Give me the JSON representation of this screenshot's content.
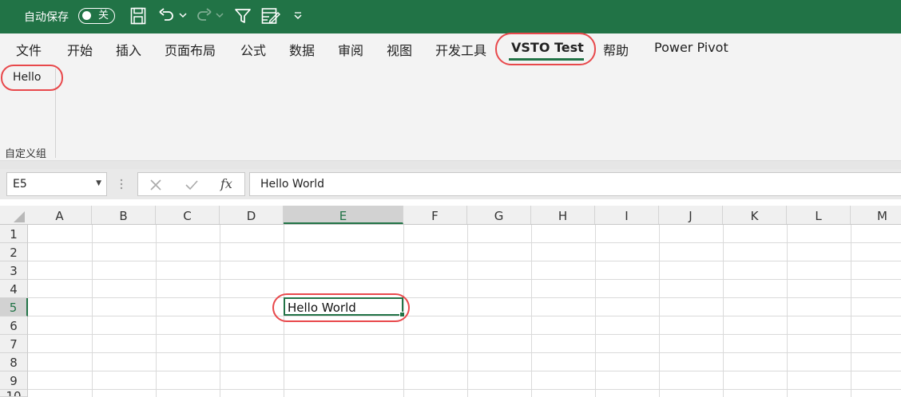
{
  "title_bar": {
    "autosave_label": "自动保存",
    "autosave_state": "关",
    "qa_icons": [
      "save-icon",
      "undo-icon",
      "redo-icon",
      "filter-icon",
      "form-icon",
      "customize-dropdown-icon"
    ]
  },
  "ribbon": {
    "tabs": [
      "文件",
      "开始",
      "插入",
      "页面布局",
      "公式",
      "数据",
      "审阅",
      "视图",
      "开发工具",
      "VSTO Test",
      "帮助",
      "Power Pivot"
    ],
    "active_tab": "VSTO Test",
    "group": {
      "button_label": "Hello",
      "label": "自定义组"
    }
  },
  "formula_bar": {
    "name_box": "E5",
    "fx_label": "fx",
    "content": "Hello World"
  },
  "sheet": {
    "columns": [
      "A",
      "B",
      "C",
      "D",
      "E",
      "F",
      "G",
      "H",
      "I",
      "J",
      "K",
      "L",
      "M"
    ],
    "rows": [
      "1",
      "2",
      "3",
      "4",
      "5",
      "6",
      "7",
      "8",
      "9",
      "10"
    ],
    "selected_cell": "E5",
    "selected_col": "E",
    "selected_row": "5",
    "cells": {
      "E5": "Hello World"
    }
  },
  "colors": {
    "accent": "#217346",
    "annotation": "#e8484b"
  }
}
